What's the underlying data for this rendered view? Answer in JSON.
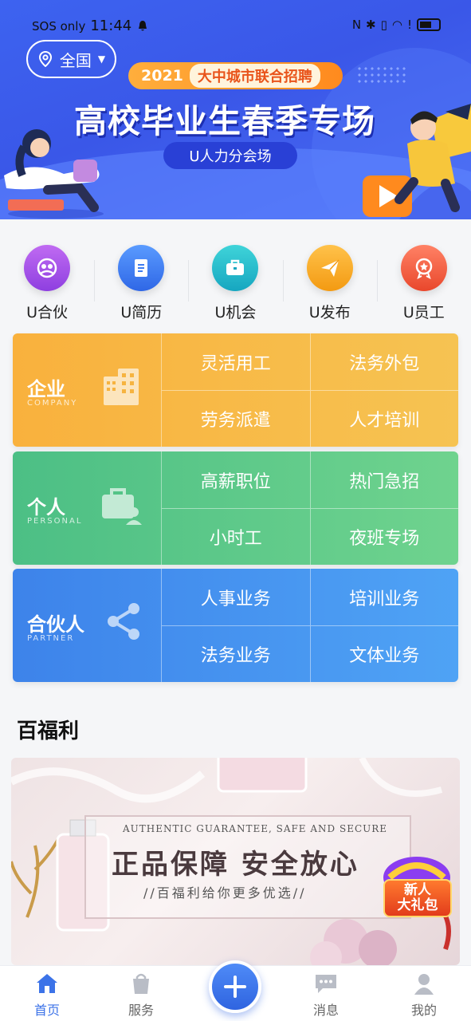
{
  "status_bar": {
    "network": "SOS only",
    "time": "11:44"
  },
  "banner": {
    "location": "全国",
    "year": "2021",
    "pill_text": "大中城市联合招聘",
    "headline": "高校毕业生春季专场",
    "subtitle": "U人力分会场"
  },
  "quick": [
    {
      "label": "U合伙",
      "color": "#a34de6"
    },
    {
      "label": "U简历",
      "color": "#3d7cf0"
    },
    {
      "label": "U机会",
      "color": "#1fb8c9"
    },
    {
      "label": "U发布",
      "color": "#f5a623"
    },
    {
      "label": "U员工",
      "color": "#f06443"
    }
  ],
  "grid": {
    "enterprise": {
      "name": "企业",
      "en": "COMPANY",
      "items": [
        "灵活用工",
        "法务外包",
        "劳务派遣",
        "人才培训"
      ]
    },
    "personal": {
      "name": "个人",
      "en": "PERSONAL",
      "items": [
        "高薪职位",
        "热门急招",
        "小时工",
        "夜班专场"
      ]
    },
    "partner": {
      "name": "合伙人",
      "en": "PARTNER",
      "items": [
        "人事业务",
        "培训业务",
        "法务业务",
        "文体业务"
      ]
    }
  },
  "section": {
    "title": "百福利"
  },
  "promo": {
    "en_line": "AUTHENTIC GUARANTEE, SAFE AND SECURE",
    "headline": "正品保障  安全放心",
    "sub": "//百福利给你更多优选//",
    "gift_line1": "新人",
    "gift_line2": "大礼包"
  },
  "tabbar": {
    "home": "首页",
    "service": "服务",
    "messages": "消息",
    "mine": "我的"
  },
  "colors": {
    "primary": "#3c73e8",
    "enterprise": "#f9b13d",
    "personal": "#4cbf85",
    "partner": "#3d83ea"
  }
}
